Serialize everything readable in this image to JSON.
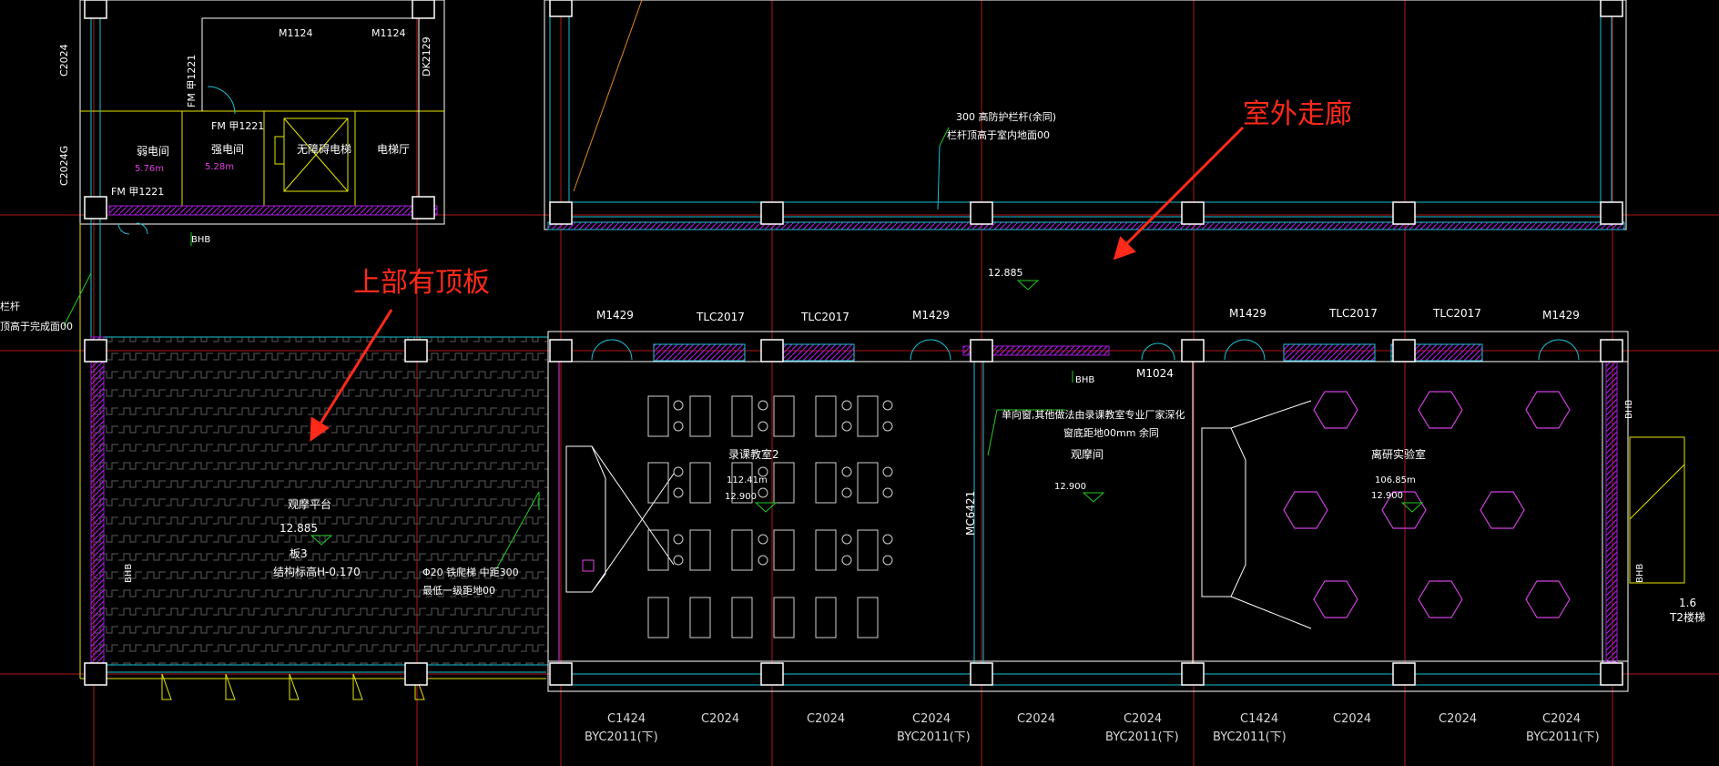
{
  "annotations": {
    "outdoor_corridor": "室外走廊",
    "roof_slab_above": "上部有顶板"
  },
  "rooms": {
    "weak_power_room": "弱电间",
    "weak_power_area": "5.76m",
    "strong_power_room": "强电间",
    "strong_power_area": "5.28m",
    "barrier_free_elevator": "无障碍电梯",
    "elevator_hall": "电梯厅",
    "observation_platform": "观摩平台",
    "observation_level": "12.885",
    "slab_type": "板3",
    "structural_level": "结构标高H-0.170",
    "recording_classroom": "录课教室2",
    "recording_classroom_area": "112.41m",
    "recording_classroom_level": "12.900",
    "observation_room": "观摩间",
    "observation_room_level": "12.900",
    "lab": "离研实验室",
    "lab_area": "106.85m",
    "lab_level": "12.900",
    "stair": "T2楼梯",
    "stair_num": "1.6"
  },
  "notes": {
    "railing_1": "300  高防护栏杆(余同)",
    "railing_2": "栏杆顶高于室内地面00",
    "one_way_window_1": "单向窗,其他做法由录课教室专业厂家深化",
    "one_way_window_2": "窗底距地00mm    余同",
    "rail_left_1": "栏杆",
    "rail_left_2": "顶高于完成面00",
    "steel_rail_1": "Φ20  铁爬梯 中距300",
    "steel_rail_2": "最低一级距地00",
    "corridor_level": "12.885"
  },
  "tags": {
    "fm1": "FM 甲1221",
    "fm2": "FM 甲1221",
    "fm3": "FM 甲1221",
    "m1124a": "M1124",
    "m1124b": "M1124",
    "dk": "DK2129",
    "c2024_top": "C2024",
    "c2024g": "C2024G",
    "bhb1": "BHB",
    "bhb2": "BHB",
    "bhb3": "BHB",
    "bhb4": "BHB",
    "bhb5": "BHB",
    "m1429_1": "M1429",
    "tlc_1": "TLC2017",
    "tlc_2": "TLC2017",
    "m1429_2": "M1429",
    "m1024": "M1024",
    "m1429_3": "M1429",
    "tlc_3": "TLC2017",
    "tlc_4": "TLC2017",
    "m1429_4": "M1429",
    "mc6421": "MC6421"
  },
  "bottom_labels": {
    "c1424_1": "C1424",
    "byc_1": "BYC2011(下)",
    "c2024_1": "C2024",
    "c2024_2": "C2024",
    "c2024_3": "C2024",
    "byc_2": "BYC2011(下)",
    "c2024_4": "C2024",
    "c2024_5": "C2024",
    "byc_3": "BYC2011(下)",
    "c1424_2": "C1424",
    "byc_4": "BYC2011(下)",
    "c2024_6": "C2024",
    "c2024_7": "C2024",
    "c2024_8": "C2024",
    "byc_5": "BYC2011(下)"
  },
  "colors": {
    "background": "#000000",
    "axis": "#b01818",
    "wall": "#ffffff",
    "window": "#19c2d6",
    "hatch": "#a21ad6",
    "label": "#ffffff",
    "furniture": "#d040e0",
    "annotation": "#ff2a1a"
  }
}
